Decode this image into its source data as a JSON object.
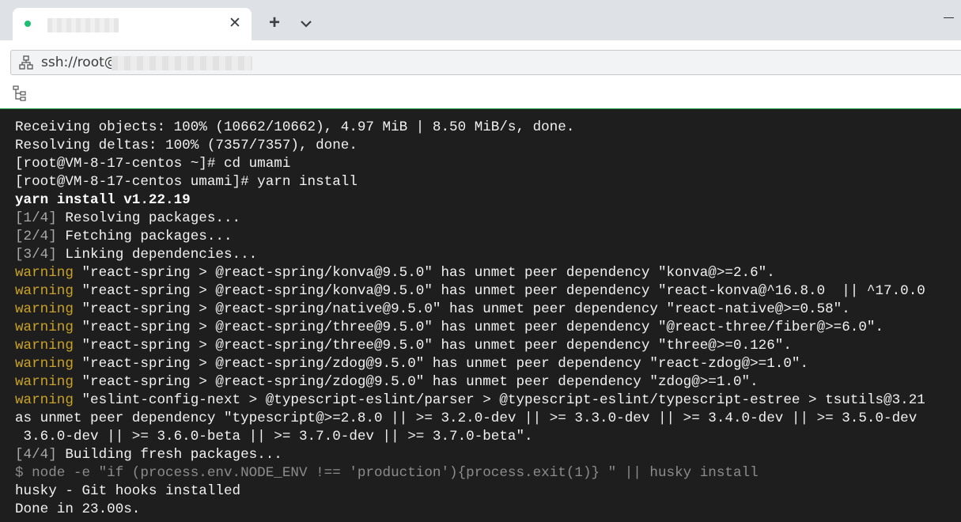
{
  "browser": {
    "tab_title": "",
    "new_tab_label": "+",
    "close_label": "✕",
    "url_prefix": "ssh://root@"
  },
  "icons": {
    "tab_status": "status-dot-icon",
    "new_tab": "plus-icon",
    "tab_list": "chevron-down-icon",
    "minimize": "minimize-icon",
    "site": "network-icon",
    "sftp": "file-tree-icon"
  },
  "colors": {
    "terminal_bg": "#1e1e1e",
    "terminal_fg": "#f2f2f2",
    "warning": "#c9a227",
    "step_prefix": "#a8a8a8",
    "accent_border": "#1fa64a",
    "status_dot": "#1dbf73"
  },
  "terminal": {
    "lines": [
      {
        "text": "Receiving objects: 100% (10662/10662), 4.97 MiB | 8.50 MiB/s, done."
      },
      {
        "text": "Resolving deltas: 100% (7357/7357), done."
      },
      {
        "text": "[root@VM-8-17-centos ~]# cd umami"
      },
      {
        "text": "[root@VM-8-17-centos umami]# yarn install"
      },
      {
        "text": "yarn install v1.22.19"
      },
      {
        "prefix": "[1/4]",
        "text": " Resolving packages..."
      },
      {
        "prefix": "[2/4]",
        "text": " Fetching packages..."
      },
      {
        "prefix": "[3/4]",
        "text": " Linking dependencies..."
      },
      {
        "prefix": "warning",
        "text": " \"react-spring > @react-spring/konva@9.5.0\" has unmet peer dependency \"konva@>=2.6\"."
      },
      {
        "prefix": "warning",
        "text": " \"react-spring > @react-spring/konva@9.5.0\" has unmet peer dependency \"react-konva@^16.8.0  || ^17.0.0"
      },
      {
        "prefix": "warning",
        "text": " \"react-spring > @react-spring/native@9.5.0\" has unmet peer dependency \"react-native@>=0.58\"."
      },
      {
        "prefix": "warning",
        "text": " \"react-spring > @react-spring/three@9.5.0\" has unmet peer dependency \"@react-three/fiber@>=6.0\"."
      },
      {
        "prefix": "warning",
        "text": " \"react-spring > @react-spring/three@9.5.0\" has unmet peer dependency \"three@>=0.126\"."
      },
      {
        "prefix": "warning",
        "text": " \"react-spring > @react-spring/zdog@9.5.0\" has unmet peer dependency \"react-zdog@>=1.0\"."
      },
      {
        "prefix": "warning",
        "text": " \"react-spring > @react-spring/zdog@9.5.0\" has unmet peer dependency \"zdog@>=1.0\"."
      },
      {
        "prefix": "warning",
        "text": " \"eslint-config-next > @typescript-eslint/parser > @typescript-eslint/typescript-estree > tsutils@3.21"
      },
      {
        "text": "as unmet peer dependency \"typescript@>=2.8.0 || >= 3.2.0-dev || >= 3.3.0-dev || >= 3.4.0-dev || >= 3.5.0-dev"
      },
      {
        "text": " 3.6.0-dev || >= 3.6.0-beta || >= 3.7.0-dev || >= 3.7.0-beta\"."
      },
      {
        "prefix": "[4/4]",
        "text": " Building fresh packages..."
      },
      {
        "text": "$ node -e \"if (process.env.NODE_ENV !== 'production'){process.exit(1)} \" || husky install"
      },
      {
        "text": "husky - Git hooks installed"
      },
      {
        "text": "Done in 23.00s."
      }
    ]
  }
}
